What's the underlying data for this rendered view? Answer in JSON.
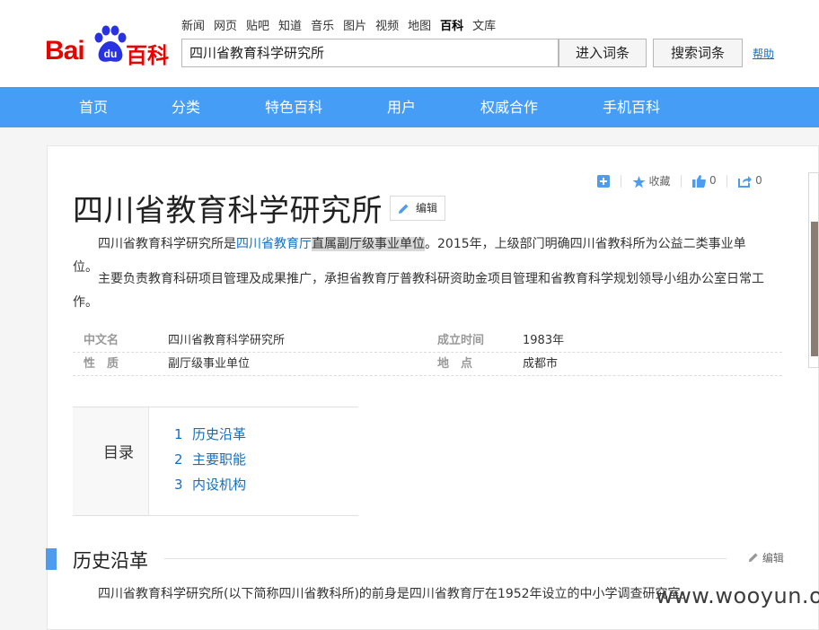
{
  "logo": {
    "text1": "Bai",
    "paw_text": "du",
    "text2": "百科"
  },
  "topnav": [
    {
      "label": "新闻",
      "active": false
    },
    {
      "label": "网页",
      "active": false
    },
    {
      "label": "贴吧",
      "active": false
    },
    {
      "label": "知道",
      "active": false
    },
    {
      "label": "音乐",
      "active": false
    },
    {
      "label": "图片",
      "active": false
    },
    {
      "label": "视频",
      "active": false
    },
    {
      "label": "地图",
      "active": false
    },
    {
      "label": "百科",
      "active": true
    },
    {
      "label": "文库",
      "active": false
    }
  ],
  "search": {
    "value": "四川省教育科学研究所",
    "enter_label": "进入词条",
    "search_label": "搜索词条",
    "help_label": "帮助"
  },
  "mainnav": [
    "首页",
    "分类",
    "特色百科",
    "用户",
    "权威合作",
    "手机百科"
  ],
  "actions": {
    "collect_label": "收藏",
    "like_count": "0",
    "share_count": "0"
  },
  "entry": {
    "title": "四川省教育科学研究所",
    "edit_label": "编辑",
    "summary": {
      "prefix": "四川省教育科学研究所是",
      "link": "四川省教育厅",
      "highlight": "直属副厅级事业单位",
      "suffix": "。2015年，上级部门明确四川省教科所为公益二类事业单位。"
    },
    "para2": "主要负责教育科研项目管理及成果推广，承担省教育厅普教科研资助金项目管理和省教育科学规划领导小组办公室日常工作。",
    "basic_info": [
      {
        "k1": "中文名",
        "v1": "四川省教育科学研究所",
        "k2": "成立时间",
        "v2": "1983年"
      },
      {
        "k1": "性　质",
        "v1": "副厅级事业单位",
        "k2": "地　点",
        "v2": "成都市"
      }
    ]
  },
  "toc": {
    "label": "目录",
    "items": [
      {
        "num": "1",
        "label": "历史沿革"
      },
      {
        "num": "2",
        "label": "主要职能"
      },
      {
        "num": "3",
        "label": "内设机构"
      }
    ]
  },
  "section1": {
    "title": "历史沿革",
    "edit_label": "编辑",
    "text": "四川省教育科学研究所(以下简称四川省教科所)的前身是四川省教育厅在1952年设立的中小学调查研究室。"
  },
  "watermark": "www.wooyun.org",
  "colors": {
    "brand_red": "#e10602",
    "nav_blue": "#459df5",
    "link_blue": "#136ec2"
  }
}
